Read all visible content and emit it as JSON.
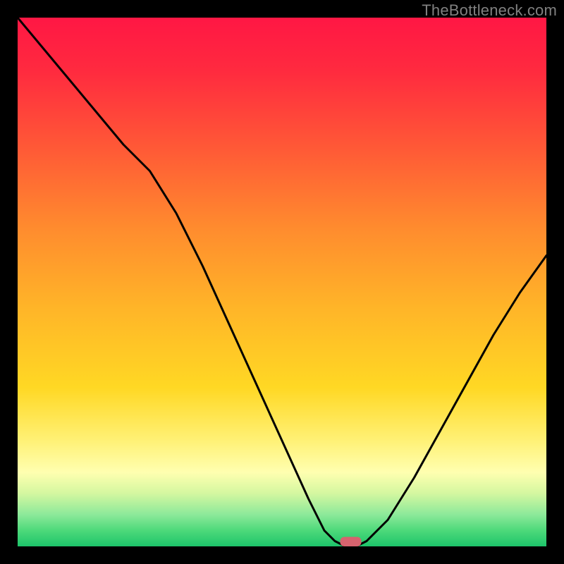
{
  "watermark": "TheBottleneck.com",
  "chart_data": {
    "type": "line",
    "title": "",
    "xlabel": "",
    "ylabel": "",
    "xlim": [
      0,
      100
    ],
    "ylim": [
      0,
      100
    ],
    "grid": false,
    "legend": false,
    "x": [
      0,
      5,
      10,
      15,
      20,
      25,
      30,
      35,
      40,
      45,
      50,
      55,
      58,
      60,
      62,
      64,
      66,
      70,
      75,
      80,
      85,
      90,
      95,
      100
    ],
    "values": [
      100,
      94,
      88,
      82,
      76,
      71,
      63,
      53,
      42,
      31,
      20,
      9,
      3,
      1,
      0,
      0,
      1,
      5,
      13,
      22,
      31,
      40,
      48,
      55
    ],
    "background_gradient": {
      "stops": [
        {
          "offset": 0.0,
          "color": "#ff1744"
        },
        {
          "offset": 0.1,
          "color": "#ff2a3f"
        },
        {
          "offset": 0.25,
          "color": "#ff5a36"
        },
        {
          "offset": 0.4,
          "color": "#ff8c2e"
        },
        {
          "offset": 0.55,
          "color": "#ffb528"
        },
        {
          "offset": 0.7,
          "color": "#ffd824"
        },
        {
          "offset": 0.8,
          "color": "#fff176"
        },
        {
          "offset": 0.86,
          "color": "#ffffb0"
        },
        {
          "offset": 0.9,
          "color": "#d4f7a0"
        },
        {
          "offset": 0.94,
          "color": "#8ce99a"
        },
        {
          "offset": 0.97,
          "color": "#4dd97a"
        },
        {
          "offset": 1.0,
          "color": "#1dc46a"
        }
      ]
    },
    "marker": {
      "x": 63,
      "y": 0,
      "width": 4,
      "height": 1.8,
      "color": "#d6636e"
    }
  }
}
